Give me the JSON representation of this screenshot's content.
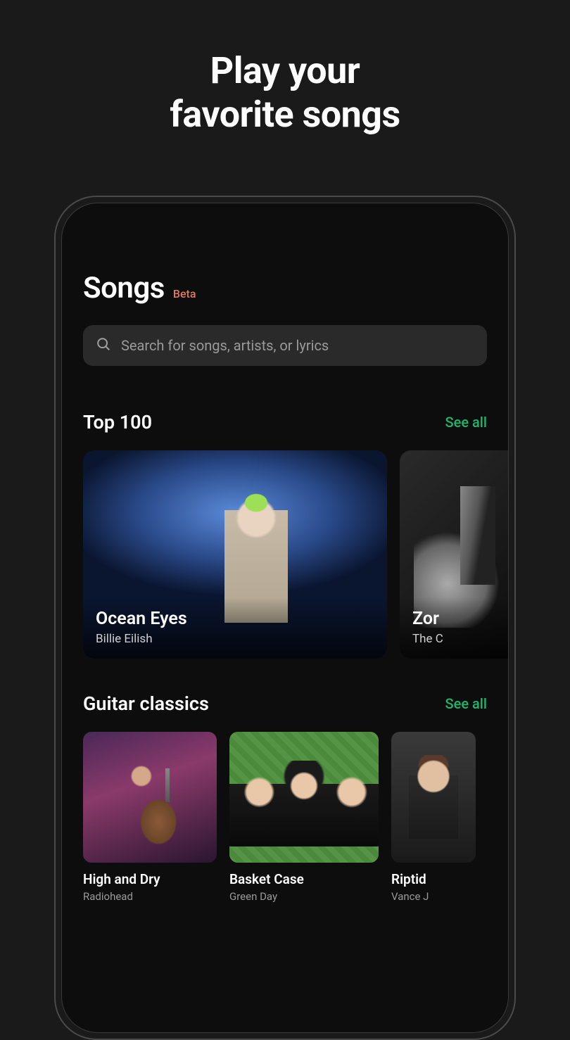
{
  "hero": {
    "line1": "Play your",
    "line2": "favorite songs"
  },
  "screen": {
    "title": "Songs",
    "badge": "Beta"
  },
  "search": {
    "placeholder": "Search for songs, artists, or lyrics"
  },
  "sections": [
    {
      "title": "Top 100",
      "see_all": "See all",
      "cards": [
        {
          "title": "Ocean Eyes",
          "subtitle": "Billie Eilish"
        },
        {
          "title": "Zor",
          "subtitle": "The C"
        }
      ]
    },
    {
      "title": "Guitar classics",
      "see_all": "See all",
      "cards": [
        {
          "title": "High and Dry",
          "subtitle": "Radiohead"
        },
        {
          "title": "Basket Case",
          "subtitle": "Green Day"
        },
        {
          "title": "Riptid",
          "subtitle": "Vance J"
        }
      ]
    }
  ]
}
